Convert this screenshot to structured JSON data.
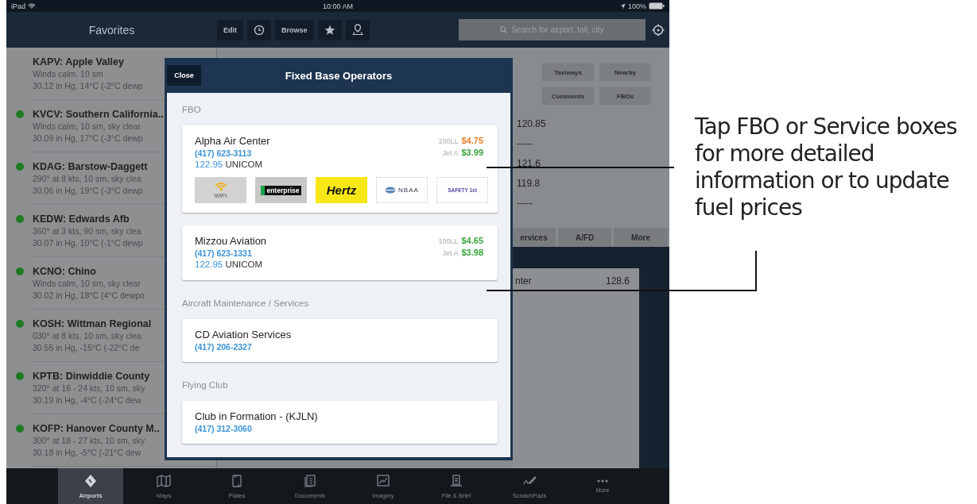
{
  "status_bar": {
    "carrier": "iPad",
    "time": "10:00 AM",
    "battery": "100%"
  },
  "nav_bar": {
    "title": "Favorites",
    "edit_label": "Edit",
    "browse_label": "Browse",
    "search_placeholder": "Search for airport, tail, city"
  },
  "favorites": [
    {
      "title": "KAPV: Apple Valley",
      "line_1": "Winds calm, 10 sm",
      "line_2": "30.12 in Hg, 14°C (-2°C dewp"
    },
    {
      "title": "KVCV: Southern California..",
      "line_1": "Winds calm, 10 sm, sky clear",
      "line_2": "30.09 in Hg, 17°C (-3°C dewp",
      "color": "#1e7a22"
    },
    {
      "title": "KDAG: Barstow-Daggett",
      "line_1": "290° at 8 kts, 10 sm, sky clea",
      "line_2": "30.06 in Hg, 19°C (-3°C dewp",
      "color": "#1e7a22"
    },
    {
      "title": "KEDW: Edwards Afb",
      "line_1": "360° at 3 kts, 90 sm, sky clea",
      "line_2": "30.07 in Hg, 10°C (-1°C dewp",
      "color": "#1e7a22"
    },
    {
      "title": "KCNO: Chino",
      "line_1": "Winds calm, 10 sm, sky clear",
      "line_2": "30.02 in Hg, 18°C (4°C dewpo",
      "color": "#1e7a22"
    },
    {
      "title": "KOSH: Wittman Regional",
      "line_1": "030° at 8 kts, 10 sm, sky clea",
      "line_2": "30.55 in Hg, -15°C (-22°C de",
      "color": "#1e7a22"
    },
    {
      "title": "KPTB: Dinwiddie County",
      "line_1": "320° at 16 - 24 kts, 10 sm, sky",
      "line_2": "30.19 in Hg, -4°C (-24°C dew",
      "color": "#1e7a22"
    },
    {
      "title": "KOFP: Hanover County M..",
      "line_1": "300° at 18 - 27 kts, 10 sm, sky",
      "line_2": "30.18 in Hg, -5°C (-21°C dew",
      "color": "#1e7a22"
    }
  ],
  "airport_panel": {
    "buttons": [
      "Taxiways",
      "Nearby",
      "Comments",
      "FBOs"
    ],
    "frequencies": [
      "120.85",
      "-----",
      "121.6",
      "119.8",
      "-----"
    ],
    "tabs": [
      {
        "label": "ervices",
        "selected": false
      },
      {
        "label": "A/FD",
        "selected": false
      },
      {
        "label": "More",
        "selected": false
      }
    ],
    "list_row": {
      "column_1": "nter",
      "column_2": "128.6"
    }
  },
  "modal": {
    "close_label": "Close",
    "title": "Fixed Base Operators",
    "sections": [
      {
        "heading": "FBO",
        "cards": [
          {
            "name": "Alpha Air Center",
            "phone": "(417) 623-3113",
            "frequency": "122.95",
            "frequency_label": "UNICOM",
            "fuel": [
              {
                "grade": "100LL",
                "price": "$4.75",
                "color": "#e8802a"
              },
              {
                "grade": "Jet A",
                "price": "$3.99",
                "color": "#39a33a"
              }
            ],
            "amenities": [
              {
                "kind": "wifi",
                "label": "WiFi"
              },
              {
                "kind": "band",
                "label": "enterprise"
              },
              {
                "kind": "yellow",
                "label": "Hertz"
              },
              {
                "kind": "emblem",
                "label": "NBAA"
              },
              {
                "kind": "faint",
                "label": "SAFETY 1st"
              }
            ]
          },
          {
            "name": "Mizzou Aviation",
            "phone": "(417) 623-1331",
            "frequency": "122.95",
            "frequency_label": "UNICOM",
            "fuel": [
              {
                "grade": "100LL",
                "price": "$4.65",
                "color": "#39a33a"
              },
              {
                "grade": "Jet A",
                "price": "$3.98",
                "color": "#39a33a"
              }
            ]
          }
        ]
      },
      {
        "heading": "Aircraft Maintenance / Services",
        "cards": [
          {
            "name": "CD Aviation Services",
            "phone": "(417) 206-2327"
          }
        ]
      },
      {
        "heading": "Flying Club",
        "cards": [
          {
            "name": "Club in Formation - (KJLN)",
            "phone": "(417) 312-3060"
          }
        ]
      }
    ]
  },
  "tab_bar": [
    {
      "label": "Airports",
      "selected": true
    },
    {
      "label": "Maps",
      "selected": false
    },
    {
      "label": "Plates",
      "selected": false
    },
    {
      "label": "Documents",
      "selected": false
    },
    {
      "label": "Imagery",
      "selected": false
    },
    {
      "label": "File & Brief",
      "selected": false
    },
    {
      "label": "ScratchPads",
      "selected": false
    },
    {
      "label": "More",
      "selected": false
    }
  ],
  "callout": {
    "text": "Tap FBO or Service boxes for more detailed information or to update fuel prices"
  }
}
